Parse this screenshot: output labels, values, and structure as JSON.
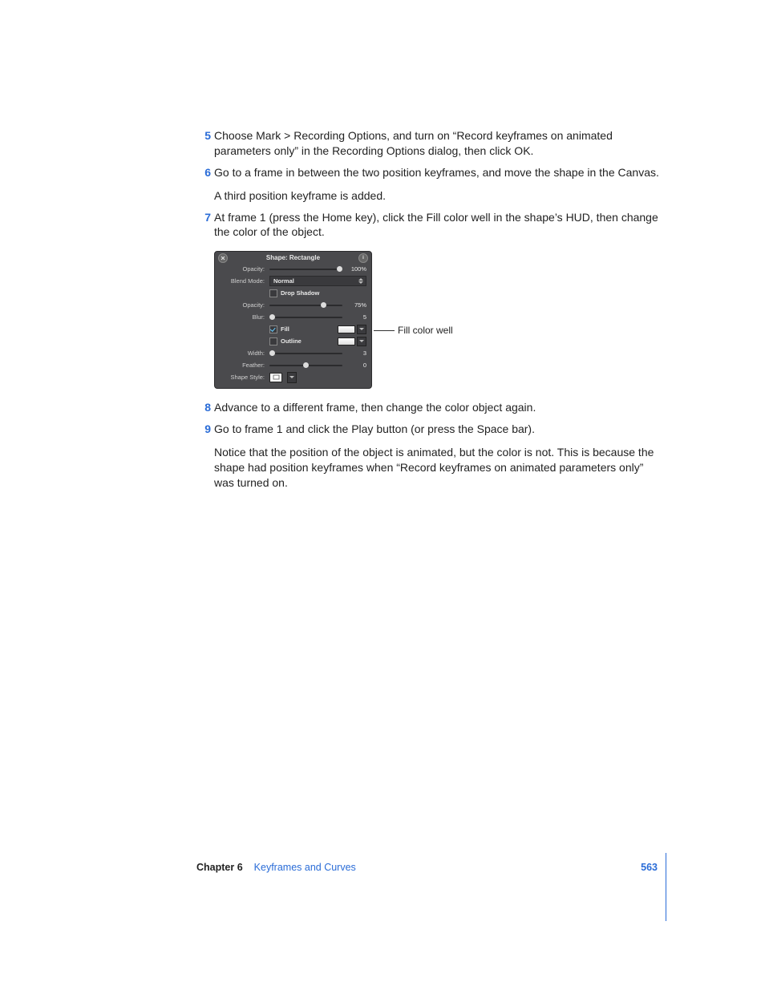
{
  "steps": [
    {
      "n": "5",
      "text": "Choose Mark > Recording Options, and turn on “Record keyframes on animated parameters only” in the Recording Options dialog, then click OK."
    },
    {
      "n": "6",
      "text": "Go to a frame in between the two position keyframes, and move the shape in the Canvas.",
      "sub": "A third position keyframe is added."
    },
    {
      "n": "7",
      "text": "At frame 1 (press the Home key), click the Fill color well in the shape’s HUD, then change the color of the object."
    }
  ],
  "steps_after": [
    {
      "n": "8",
      "text": "Advance to a different frame, then change the color object again."
    },
    {
      "n": "9",
      "text": "Go to frame 1 and click the Play button (or press the Space bar).",
      "sub": "Notice that the position of the object is animated, but the color is not. This is because the shape had position keyframes when “Record keyframes on animated parameters only” was turned on."
    }
  ],
  "hud": {
    "title": "Shape: Rectangle",
    "opacity": {
      "label": "Opacity:",
      "value": "100%"
    },
    "blend": {
      "label": "Blend Mode:",
      "value": "Normal"
    },
    "dropshadow": {
      "label": "Drop Shadow"
    },
    "opacity2": {
      "label": "Opacity:",
      "value": "75%"
    },
    "blur": {
      "label": "Blur:",
      "value": "5"
    },
    "fill": {
      "label": "Fill"
    },
    "outline": {
      "label": "Outline"
    },
    "width": {
      "label": "Width:",
      "value": "3"
    },
    "feather": {
      "label": "Feather:",
      "value": "0"
    },
    "shapestyle": {
      "label": "Shape Style:"
    }
  },
  "callout": "Fill color well",
  "footer": {
    "chapter": "Chapter 6",
    "title": "Keyframes and Curves",
    "page": "563"
  }
}
